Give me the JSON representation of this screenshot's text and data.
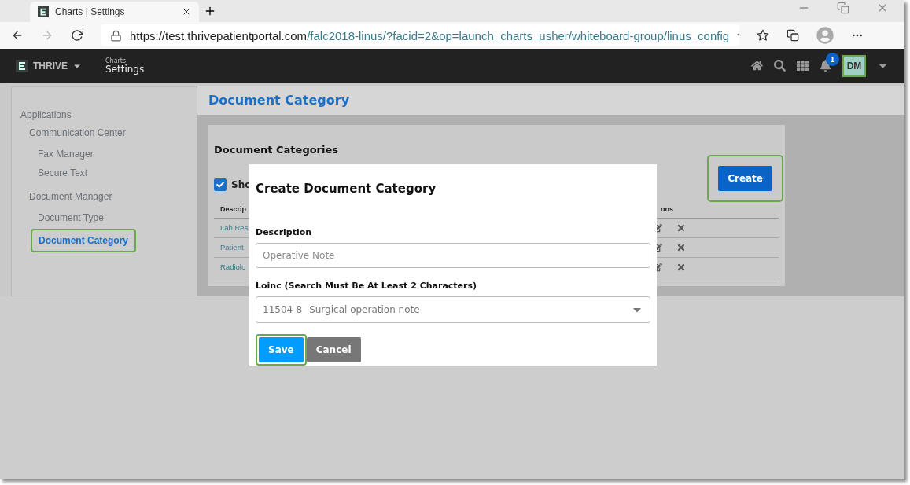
{
  "browser": {
    "tab_title": "Charts | Settings",
    "url_host": "https://test.thrivepatientportal.com",
    "url_path": "/falc2018-linus/?facid=2&op=launch_charts_usher/whiteboard-group/linus_config"
  },
  "header": {
    "brand": "THRIVE",
    "section": "Charts",
    "page": "Settings",
    "notification_count": "1",
    "user_initials": "DM"
  },
  "sidebar": {
    "items": [
      {
        "label": "Applications",
        "selected": false,
        "children": [
          {
            "label": "Communication Center",
            "selected": false,
            "children": [
              {
                "label": "Fax Manager",
                "selected": false
              },
              {
                "label": "Secure Text",
                "selected": false
              }
            ]
          },
          {
            "label": "Document Manager",
            "selected": false,
            "children": [
              {
                "label": "Document Type",
                "selected": false
              },
              {
                "label": "Document Category",
                "selected": true
              }
            ]
          }
        ]
      }
    ]
  },
  "page_title": "Document Category",
  "card": {
    "title": "Document Categories",
    "show_checkbox": {
      "label": "Sho",
      "checked": true
    },
    "create_button": "Create",
    "table": {
      "columns": [
        "Descrip",
        "ons"
      ],
      "rows": [
        [
          "Lab Res"
        ],
        [
          "Patient"
        ],
        [
          "Radiolo"
        ]
      ]
    }
  },
  "modal": {
    "title": "Create Document Category",
    "description_label": "Description",
    "description_placeholder": "Operative Note",
    "loinc_label": "Loinc (Search Must Be At Least 2 Characters)",
    "loinc_code": "11504-8",
    "loinc_name": "Surgical operation note",
    "buttons": [
      {
        "label": "Save",
        "kind": "primary"
      },
      {
        "label": "Cancel",
        "kind": "secondary"
      }
    ]
  }
}
